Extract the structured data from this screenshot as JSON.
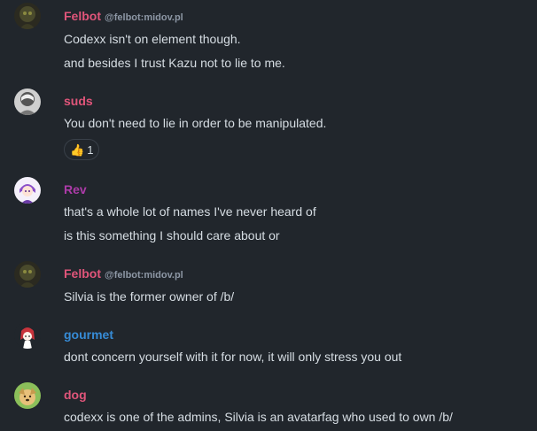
{
  "colors": {
    "background": "#21262c",
    "felbot_name": "#e0557a",
    "suds_name": "#e0557a",
    "rev_name": "#ac3ba8",
    "gourmet_name": "#368bd6",
    "dog_name": "#e0557a",
    "body_text": "#d6dde3",
    "muted": "#8d97a5"
  },
  "messages": [
    {
      "sender": "Felbot",
      "mxid": "@felbot:midov.pl",
      "avatar_icon": "felbot-avatar-icon",
      "lines": [
        "Codexx isn't on element though.",
        "and besides I trust Kazu not to lie to me."
      ]
    },
    {
      "sender": "suds",
      "avatar_icon": "suds-avatar-icon",
      "lines": [
        "You don't need to lie in order to be manipulated."
      ],
      "reaction": {
        "emoji": "👍",
        "icon": "thumbs-up-icon",
        "count": "1"
      }
    },
    {
      "sender": "Rev",
      "avatar_icon": "rev-avatar-icon",
      "lines": [
        "that's a whole lot of names I've never heard of",
        "is this something I should care about or"
      ]
    },
    {
      "sender": "Felbot",
      "mxid": "@felbot:midov.pl",
      "avatar_icon": "felbot-avatar-icon",
      "lines": [
        "Silvia is the former owner of /b/"
      ]
    },
    {
      "sender": "gourmet",
      "avatar_icon": "gourmet-avatar-icon",
      "lines": [
        "dont concern yourself with it for now, it will only stress you out"
      ]
    },
    {
      "sender": "dog",
      "avatar_icon": "dog-avatar-icon",
      "lines": [
        "codexx is one of the admins, Silvia is an avatarfag who used to own /b/"
      ]
    }
  ]
}
